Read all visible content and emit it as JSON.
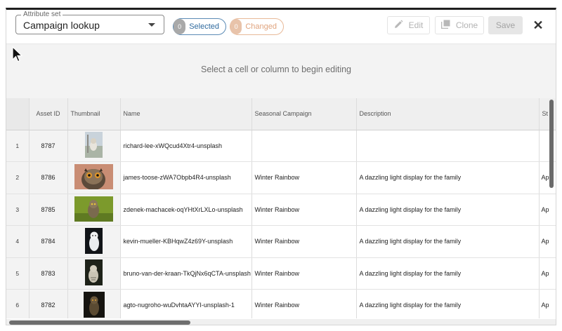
{
  "attribute_set": {
    "legend": "Attribute set",
    "value": "Campaign lookup"
  },
  "pills": {
    "selected": {
      "count": "0",
      "label": "Selected"
    },
    "changed": {
      "count": "0",
      "label": "Changed"
    }
  },
  "buttons": {
    "edit": "Edit",
    "clone": "Clone",
    "save": "Save",
    "close": "✕"
  },
  "info_message": "Select a cell or column to begin editing",
  "columns": [
    "",
    "Asset ID",
    "Thumbnail",
    "Name",
    "Seasonal Campaign",
    "Description",
    "St"
  ],
  "rows": [
    {
      "num": "1",
      "asset_id": "8787",
      "name": "richard-lee-xWQcud4Xtr4-unsplash",
      "campaign": "",
      "description": "",
      "status": ""
    },
    {
      "num": "2",
      "asset_id": "8786",
      "name": "james-toose-zWA7Obpb4R4-unsplash",
      "campaign": "Winter Rainbow",
      "description": "A dazzling light display for the family",
      "status": "Ap"
    },
    {
      "num": "3",
      "asset_id": "8785",
      "name": "zdenek-machacek-oqYHtXrLXLo-unsplash",
      "campaign": "Winter Rainbow",
      "description": "A dazzling light display for the family",
      "status": "Ap"
    },
    {
      "num": "4",
      "asset_id": "8784",
      "name": "kevin-mueller-KBHqwZ4z69Y-unsplash",
      "campaign": "Winter Rainbow",
      "description": "A dazzling light display for the family",
      "status": "Ap"
    },
    {
      "num": "5",
      "asset_id": "8783",
      "name": "bruno-van-der-kraan-TkQjNx6qCTA-unsplash",
      "campaign": "Winter Rainbow",
      "description": "A dazzling light display for the family",
      "status": "Ap"
    },
    {
      "num": "6",
      "asset_id": "8782",
      "name": "agto-nugroho-wuDvhtaAYYI-unsplash-1",
      "campaign": "Winter Rainbow",
      "description": "A dazzling light display for the family",
      "status": "Ap"
    }
  ],
  "icons": {
    "edit": "pencil-icon",
    "clone": "copy-icon",
    "close": "close-icon",
    "dropdown": "chevron-down-icon",
    "cursor": "mouse-pointer-icon"
  },
  "colors": {
    "selected_accent": "#2f6a9e",
    "changed_accent": "#e0a47e"
  }
}
